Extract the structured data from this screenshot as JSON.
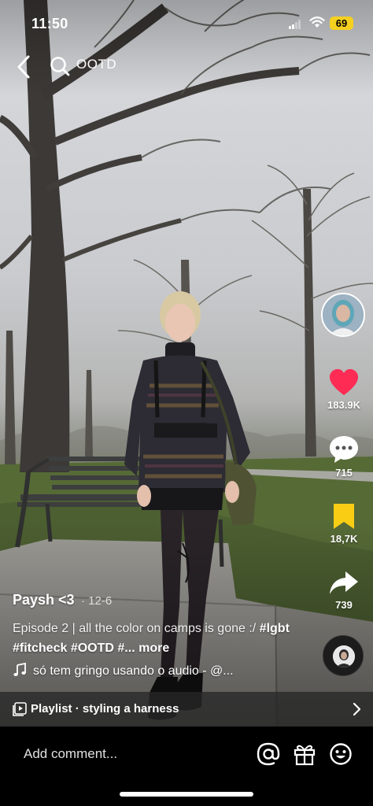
{
  "status_bar": {
    "time": "11:50",
    "battery": "69",
    "battery_color": "#f5d01f"
  },
  "search": {
    "query": "OOTD",
    "back_icon": "chevron-left-icon",
    "search_icon": "search-icon"
  },
  "rail": {
    "like_count": "183.9K",
    "comment_count": "715",
    "save_count": "18,7K",
    "share_count": "739",
    "like_color": "#fe2c55",
    "save_color": "#facd15"
  },
  "post": {
    "author": "Paysh <3",
    "date": "· 12-6",
    "caption_text": "Episode 2 | all the color on camps is gone :/",
    "hashtags": [
      "#lgbt",
      "#fitcheck",
      "#OOTD",
      "#..."
    ],
    "more_label": "more",
    "sound": "só tem gringo usando o audio - @..."
  },
  "playlist": {
    "label": "Playlist · styling a harness"
  },
  "comment_bar": {
    "placeholder": "Add comment...",
    "icons": [
      "at-icon",
      "gift-icon",
      "emoji-icon"
    ]
  }
}
